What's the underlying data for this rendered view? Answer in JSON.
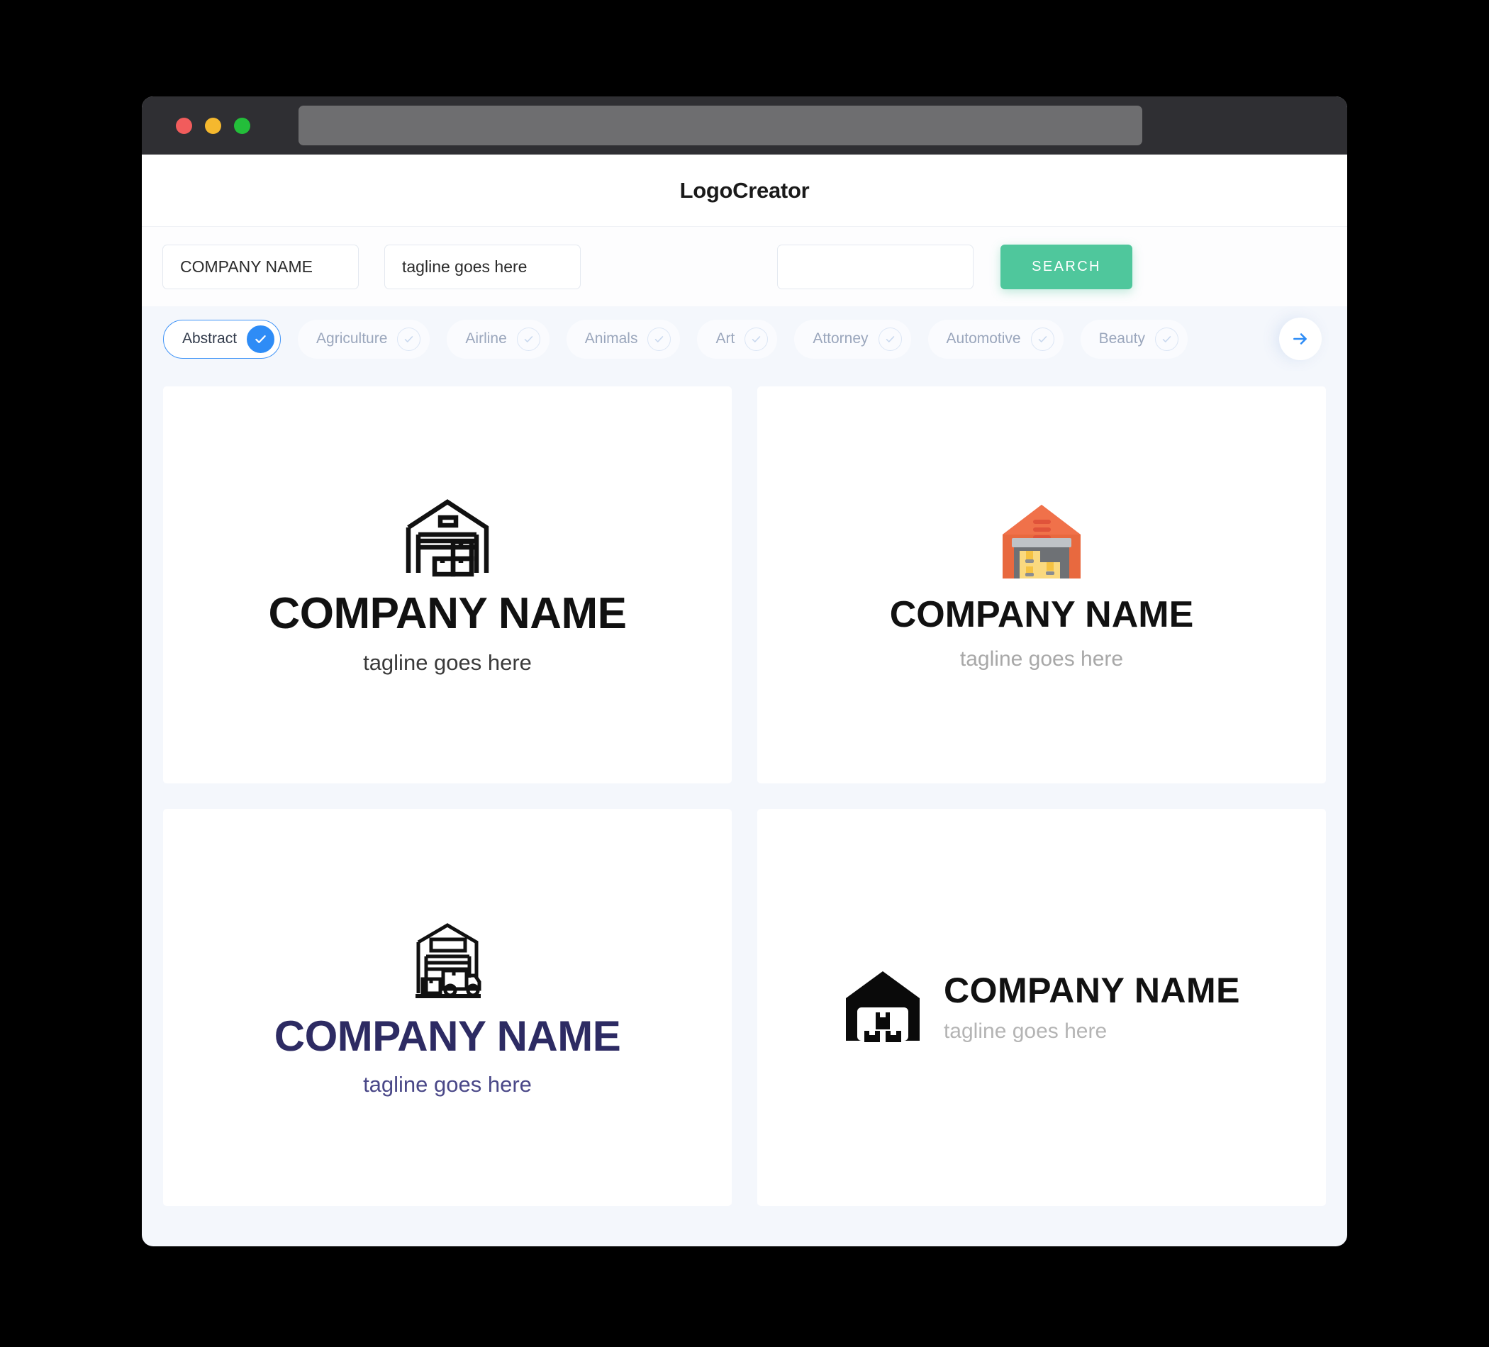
{
  "window": {
    "traffic_lights": [
      {
        "name": "close",
        "color": "#F15C5C"
      },
      {
        "name": "minimize",
        "color": "#F5B82E"
      },
      {
        "name": "zoom",
        "color": "#23BE3A"
      }
    ],
    "url_value": ""
  },
  "header": {
    "title": "LogoCreator"
  },
  "search": {
    "company_value": "COMPANY NAME",
    "company_placeholder": "COMPANY NAME",
    "tagline_value": "tagline goes here",
    "tagline_placeholder": "tagline goes here",
    "keyword_value": "",
    "keyword_placeholder": "",
    "button_label": "SEARCH",
    "button_color": "#4FC79C"
  },
  "categories": {
    "selected": "Abstract",
    "accent_color": "#2E8CF6",
    "next_label": "next",
    "items": [
      {
        "label": "Abstract",
        "selected": true
      },
      {
        "label": "Agriculture",
        "selected": false
      },
      {
        "label": "Airline",
        "selected": false
      },
      {
        "label": "Animals",
        "selected": false
      },
      {
        "label": "Art",
        "selected": false
      },
      {
        "label": "Attorney",
        "selected": false
      },
      {
        "label": "Automotive",
        "selected": false
      },
      {
        "label": "Beauty",
        "selected": false
      }
    ]
  },
  "results": [
    {
      "id": "logo-1",
      "layout": "stacked",
      "icon": "warehouse-outline-boxes-icon",
      "name": "COMPANY NAME",
      "tagline": "tagline goes here",
      "name_color": "#111111",
      "tagline_color": "#3A3A3A"
    },
    {
      "id": "logo-2",
      "layout": "stacked",
      "icon": "warehouse-color-boxes-icon",
      "name": "COMPANY NAME",
      "tagline": "tagline goes here",
      "name_color": "#111111",
      "tagline_color": "#A8A8A8",
      "icon_colors": {
        "roof": "#F0714A",
        "wall": "#E8693F",
        "shutter": "#BFC3C7",
        "interior": "#6E7175",
        "box_light": "#FAD97F",
        "box_dark": "#F5C242",
        "vent": "#E0533A",
        "box_strap": "#8A8D91"
      }
    },
    {
      "id": "logo-3",
      "layout": "stacked",
      "icon": "warehouse-truck-outline-icon",
      "name": "COMPANY NAME",
      "tagline": "tagline goes here",
      "name_color": "#2D2B63",
      "tagline_color": "#4A4888"
    },
    {
      "id": "logo-4",
      "layout": "horizontal",
      "icon": "warehouse-solid-boxes-icon",
      "name": "COMPANY NAME",
      "tagline": "tagline goes here",
      "name_color": "#111111",
      "tagline_color": "#B4B4B4"
    }
  ]
}
